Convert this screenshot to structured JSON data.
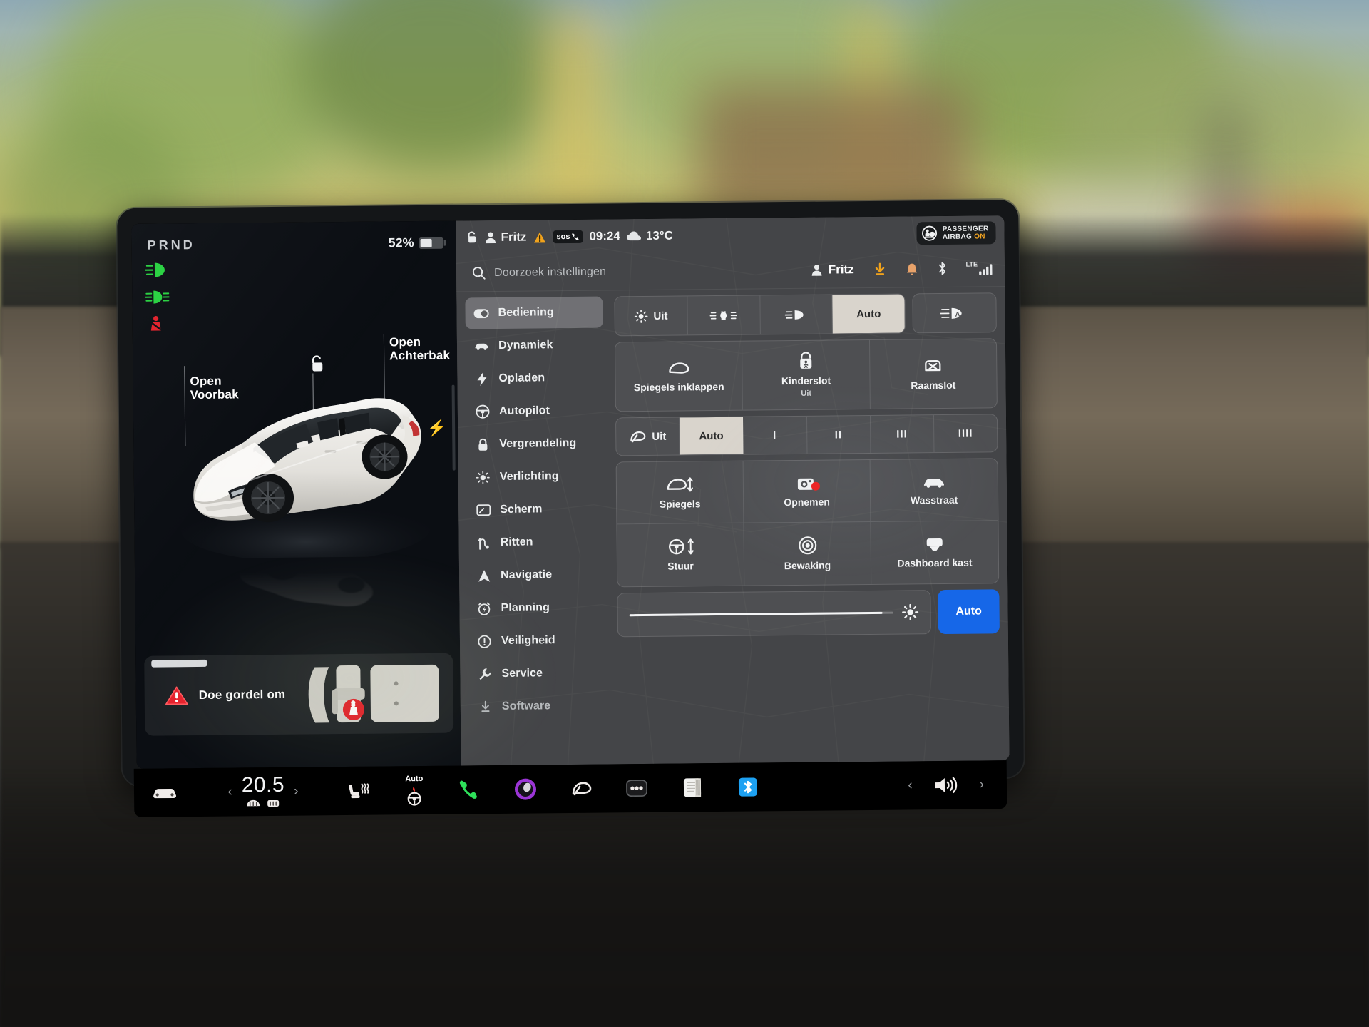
{
  "vehicle_panel": {
    "gear_indicator": "PRND",
    "battery_percent": "52%",
    "battery_level": 52,
    "telltales": [
      {
        "name": "low-beam-on-icon",
        "color": "#27d13f"
      },
      {
        "name": "front-fog-light-icon",
        "color": "#27d13f"
      },
      {
        "name": "seatbelt-warning-icon",
        "color": "#e3202a"
      }
    ],
    "callouts": {
      "front_trunk_line1": "Open",
      "front_trunk_line2": "Voorbak",
      "rear_trunk_line1": "Open",
      "rear_trunk_line2": "Achterbak",
      "door_lock_icon": "unlocked-padlock-icon",
      "charge_port_icon": "charge-bolt-icon"
    },
    "alert": {
      "icon": "warning-triangle-icon",
      "message": "Doe gordel om",
      "seat_map_icon": "seat-layout-icon",
      "unbuckled_seat_badge": "seatbelt-unbuckled-icon"
    }
  },
  "status_bar": {
    "lock_icon": "unlocked-padlock-icon",
    "profile_icon": "person-icon",
    "driver_name": "Fritz",
    "hazard_icon": "hazard-triangle-icon",
    "sos_label": "sos",
    "sos_icon": "phone-handset-icon",
    "time": "09:24",
    "weather_icon": "cloud-icon",
    "temperature": "13°C",
    "airbag": {
      "icon": "passenger-airbag-icon",
      "line1": "PASSENGER",
      "line2": "AIRBAG",
      "state": "ON",
      "state_color": "#f5a623"
    }
  },
  "search": {
    "icon": "search-icon",
    "placeholder": "Doorzoek instellingen",
    "value": ""
  },
  "top_right_icons": {
    "profile_name": "Fritz",
    "profile_icon": "person-icon",
    "download_icon": "software-download-icon",
    "download_color": "#f0a21c",
    "notification_icon": "bell-icon",
    "notification_color": "#e8a26a",
    "bluetooth_icon": "bluetooth-icon",
    "signal_label": "LTE",
    "signal_icon": "cellular-signal-icon",
    "signal_bars": 4
  },
  "sidebar": {
    "items": [
      {
        "label": "Bediening",
        "icon": "toggle-switch-icon",
        "active": true
      },
      {
        "label": "Dynamiek",
        "icon": "car-side-icon",
        "active": false
      },
      {
        "label": "Opladen",
        "icon": "bolt-icon",
        "active": false
      },
      {
        "label": "Autopilot",
        "icon": "steering-wheel-icon",
        "active": false
      },
      {
        "label": "Vergrendeling",
        "icon": "padlock-icon",
        "active": false
      },
      {
        "label": "Verlichting",
        "icon": "sun-icon",
        "active": false
      },
      {
        "label": "Scherm",
        "icon": "display-icon",
        "active": false
      },
      {
        "label": "Ritten",
        "icon": "route-icon",
        "active": false
      },
      {
        "label": "Navigatie",
        "icon": "navigation-arrow-icon",
        "active": false
      },
      {
        "label": "Planning",
        "icon": "alarm-clock-icon",
        "active": false
      },
      {
        "label": "Veiligheid",
        "icon": "exclamation-circle-icon",
        "active": false
      },
      {
        "label": "Service",
        "icon": "wrench-icon",
        "active": false
      },
      {
        "label": "Software",
        "icon": "download-icon",
        "active": false
      }
    ]
  },
  "controls": {
    "lights_row": {
      "segments": [
        {
          "label": "Uit",
          "icon": "sun-icon",
          "selected": false
        },
        {
          "label": "",
          "icon": "parking-lights-icon",
          "selected": false
        },
        {
          "label": "",
          "icon": "low-beam-icon",
          "selected": false
        },
        {
          "label": "Auto",
          "icon": "",
          "selected": true
        }
      ],
      "auto_high_beam": {
        "icon": "auto-high-beam-icon",
        "selected": false
      }
    },
    "tiles_row": [
      {
        "label": "Spiegels inklappen",
        "sub": "",
        "icon": "mirror-fold-icon"
      },
      {
        "label": "Kinderslot",
        "sub": "Uit",
        "icon": "child-lock-icon"
      },
      {
        "label": "Raamslot",
        "sub": "",
        "icon": "window-lock-icon"
      }
    ],
    "wiper_row": {
      "segments": [
        {
          "label": "Uit",
          "icon": "wiper-icon",
          "selected": false
        },
        {
          "label": "Auto",
          "icon": "",
          "selected": true
        },
        {
          "label": "I",
          "icon": "",
          "selected": false
        },
        {
          "label": "II",
          "icon": "",
          "selected": false
        },
        {
          "label": "III",
          "icon": "",
          "selected": false
        },
        {
          "label": "IIII",
          "icon": "",
          "selected": false
        }
      ]
    },
    "grid": [
      {
        "label": "Spiegels",
        "icon": "mirror-adjust-icon",
        "recording": false
      },
      {
        "label": "Opnemen",
        "icon": "dashcam-record-icon",
        "recording": true
      },
      {
        "label": "Wasstraat",
        "icon": "car-wash-icon",
        "recording": false
      },
      {
        "label": "Stuur",
        "icon": "steering-adjust-icon",
        "recording": false
      },
      {
        "label": "Bewaking",
        "icon": "sentry-mode-icon",
        "recording": false
      },
      {
        "label": "Dashboard kast",
        "icon": "glovebox-icon",
        "recording": false
      }
    ],
    "brightness": {
      "icon": "brightness-icon",
      "value": 96,
      "auto_label": "Auto",
      "auto_color": "#1667e8"
    }
  },
  "dock": {
    "car_icon": "car-front-icon",
    "prev_chevron": "chevron-left-icon",
    "next_chevron": "chevron-right-icon",
    "temperature": "20.5",
    "defrost_front_icon": "defrost-front-icon",
    "defrost_rear_icon": "defrost-rear-icon",
    "seat_heater_icon": "heated-seat-icon",
    "steering_heater_label": "Auto",
    "steering_heater_icon": "heated-steering-wheel-icon",
    "apps": [
      {
        "icon": "phone-icon",
        "color": "#2ee05a"
      },
      {
        "icon": "media-icon",
        "color": "#9b35d6"
      },
      {
        "icon": "wiper-app-icon",
        "color": "#ffffff"
      },
      {
        "icon": "apps-dots-icon",
        "color": "#ffffff"
      },
      {
        "icon": "notes-icon",
        "color": "#f2f2f0"
      },
      {
        "icon": "bluetooth-app-icon",
        "color": "#1da1f2"
      }
    ],
    "volume_icon": "volume-icon",
    "volume_prev_icon": "chevron-left-icon",
    "volume_next_icon": "chevron-right-icon"
  }
}
